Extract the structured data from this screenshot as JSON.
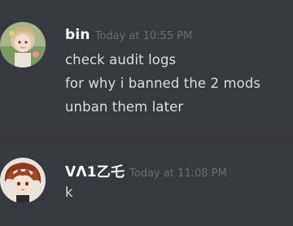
{
  "messages": [
    {
      "author": "bin",
      "timestamp": "Today at 10:55 PM",
      "lines": [
        "check audit logs",
        "for why i banned the 2 mods",
        "unban them later"
      ]
    },
    {
      "author": "ᐯᐱ1乙乇",
      "timestamp": "Today at 11:08 PM",
      "lines": [
        "k"
      ]
    }
  ],
  "colors": {
    "background": "#36393f",
    "username": "#ffffff",
    "timestamp": "#6b6f75",
    "text": "#dcddde",
    "divider": "#4a2d33"
  }
}
